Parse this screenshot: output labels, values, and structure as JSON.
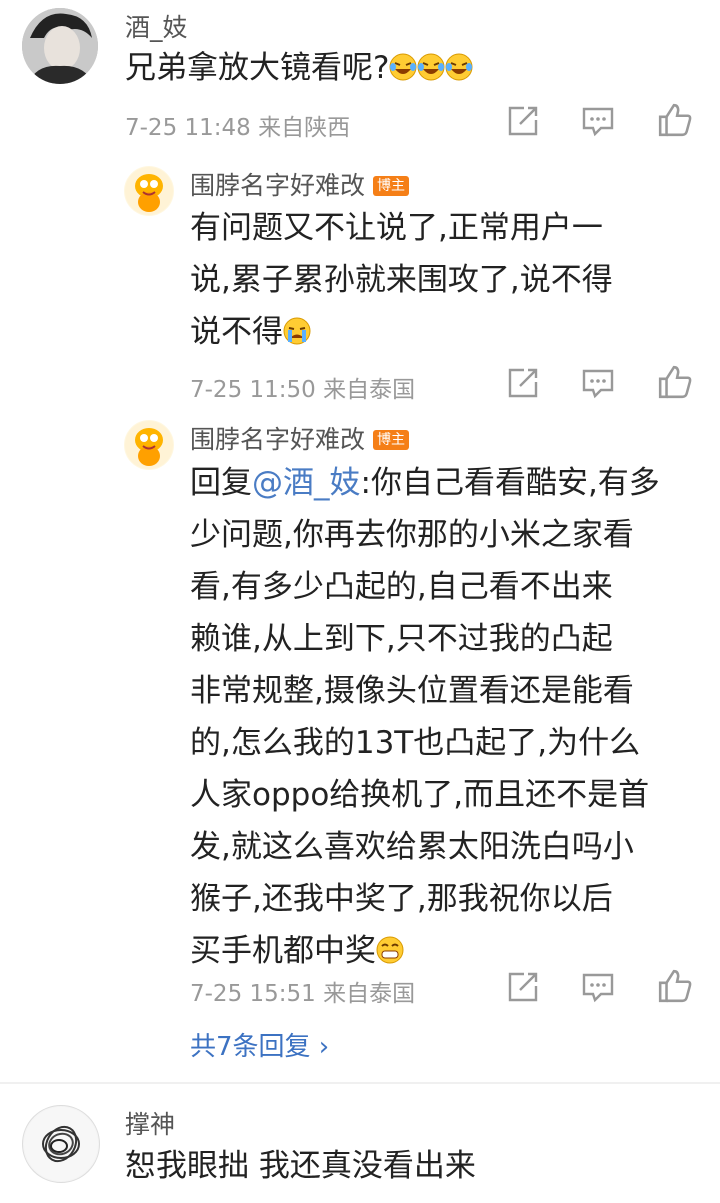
{
  "comments": [
    {
      "author": "酒_妓",
      "text": "兄弟拿放大镜看呢?",
      "meta": "7-25 11:48 来自陕西"
    },
    {
      "author": "围脖名字好难改",
      "badge": "博主",
      "text_lines": [
        "有问题又不让说了,正常用户一",
        "说,累子累孙就来围攻了,说不得",
        "说不得"
      ],
      "meta": "7-25 11:50 来自泰国"
    },
    {
      "author": "围脖名字好难改",
      "badge": "博主",
      "reply_prefix": "回复",
      "mention": "@酒_妓",
      "text_lines": [
        ":你自己看看酷安,有多",
        "少问题,你再去你那的小米之家看",
        "看,有多少凸起的,自己看不出来",
        "赖谁,从上到下,只不过我的凸起",
        "非常规整,摄像头位置看还是能看",
        "的,怎么我的13T也凸起了,为什么",
        "人家oppo给换机了,而且还不是首",
        "发,就这么喜欢给累太阳洗白吗小",
        "猴子,还我中奖了,那我祝你以后",
        "买手机都中奖"
      ],
      "meta": "7-25 15:51 来自泰国",
      "more_replies": "共7条回复 ›"
    },
    {
      "author": "撑神",
      "text": "恕我眼拙 我还真没看出来"
    }
  ],
  "icons": [
    "share-icon",
    "comment-icon",
    "like-icon"
  ],
  "colors": {
    "accent": "#3c72c2",
    "badge": "#f57f17",
    "meta": "#999999"
  }
}
